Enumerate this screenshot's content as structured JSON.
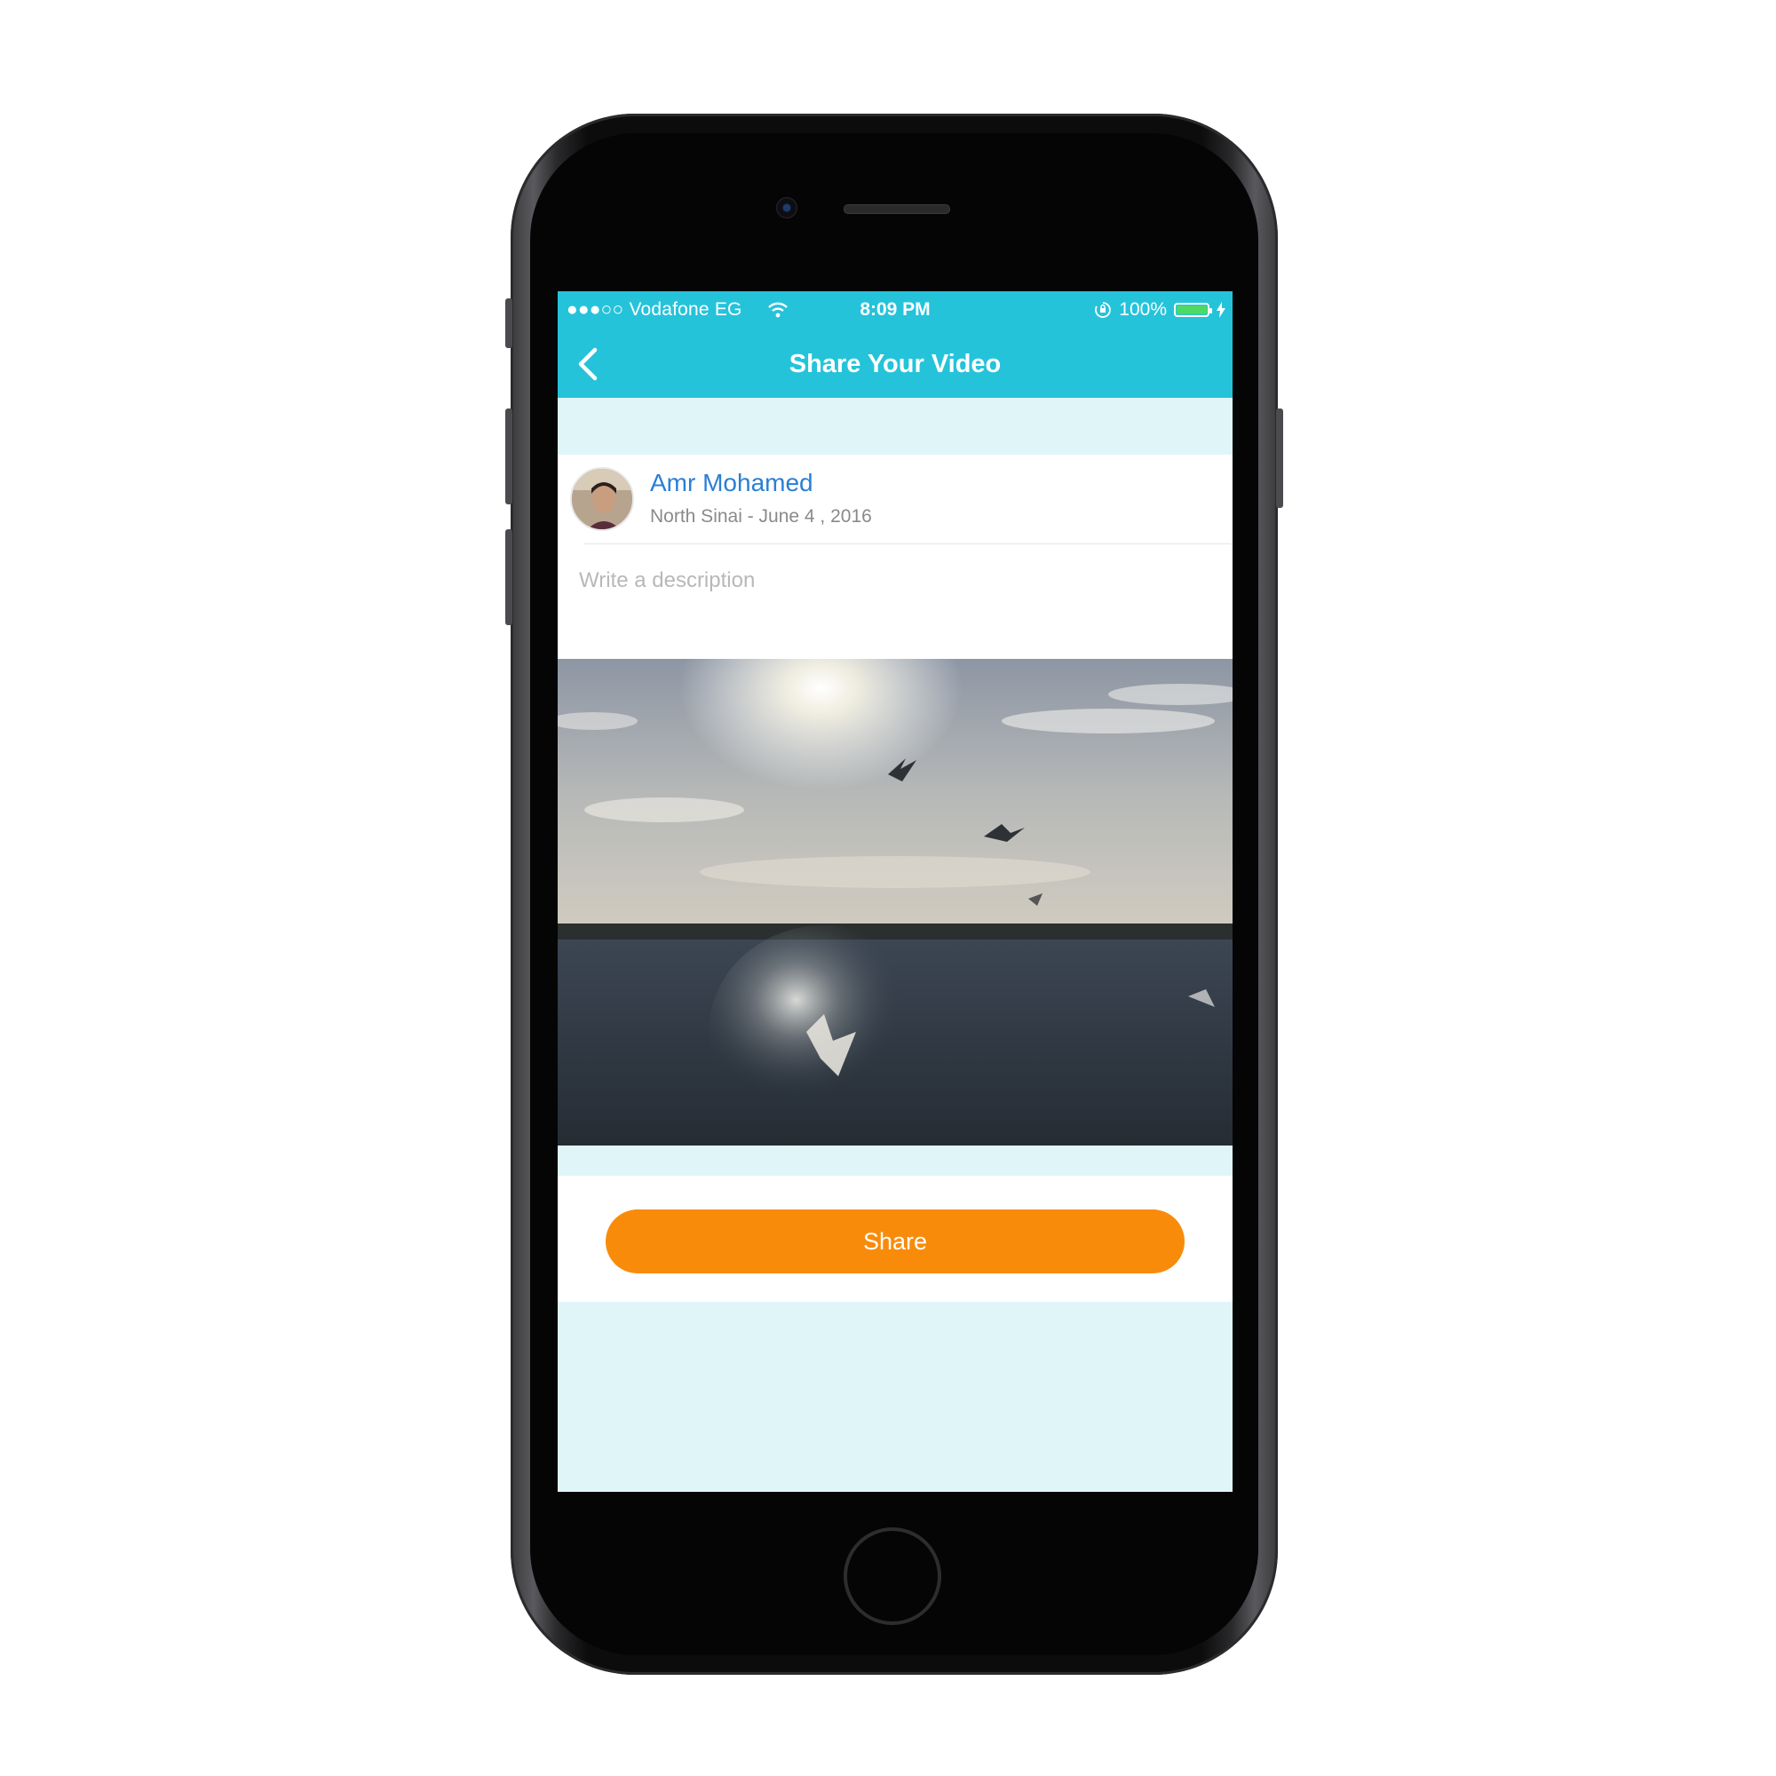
{
  "status_bar": {
    "carrier": "●●●○○ Vodafone EG",
    "time": "8:09 PM",
    "battery_text": "100%",
    "battery_level": 1.0,
    "battery_color": "#4cd964"
  },
  "nav": {
    "title": "Share Your Video",
    "back_icon": "chevron-left-icon"
  },
  "post": {
    "user_name": "Amr Mohamed",
    "meta": "North Sinai - June 4 , 2016",
    "description_placeholder": "Write a description"
  },
  "actions": {
    "share_label": "Share"
  },
  "colors": {
    "accent": "#25c3da",
    "button": "#f98b0b",
    "link": "#2a7fd4",
    "background": "#e0f5f8"
  }
}
